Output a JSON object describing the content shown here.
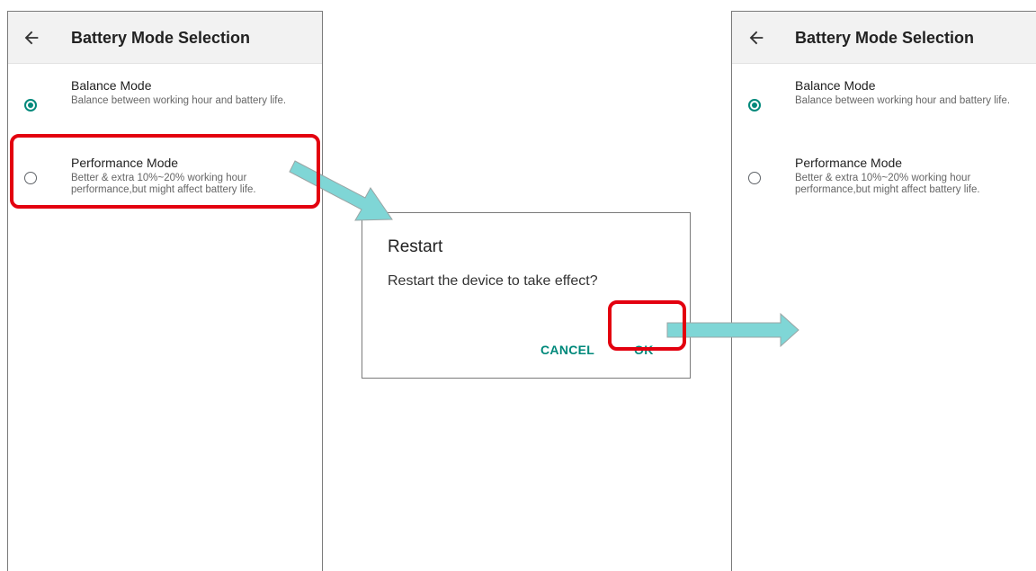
{
  "screens": [
    {
      "title": "Battery Mode Selection",
      "options": [
        {
          "title": "Balance Mode",
          "desc": "Balance between working hour and battery life.",
          "selected": true
        },
        {
          "title": "Performance Mode",
          "desc": "Better & extra 10%~20% working hour performance,but might affect battery life.",
          "selected": false
        }
      ]
    },
    {
      "title": "Battery Mode Selection",
      "options": [
        {
          "title": "Balance Mode",
          "desc": "Balance between working hour and battery life.",
          "selected": true
        },
        {
          "title": "Performance Mode",
          "desc": "Better & extra 10%~20% working hour performance,but might affect battery life.",
          "selected": false
        }
      ]
    }
  ],
  "dialog": {
    "title": "Restart",
    "message": "Restart the device to take effect?",
    "cancel_label": "CANCEL",
    "ok_label": "OK"
  },
  "colors": {
    "accent": "#00897b",
    "highlight": "#e3000f",
    "arrow_fill": "#7fd6d6"
  },
  "icons": {
    "back": "back-arrow-icon",
    "radio_on": "radio-checked-icon",
    "radio_off": "radio-unchecked-icon"
  }
}
